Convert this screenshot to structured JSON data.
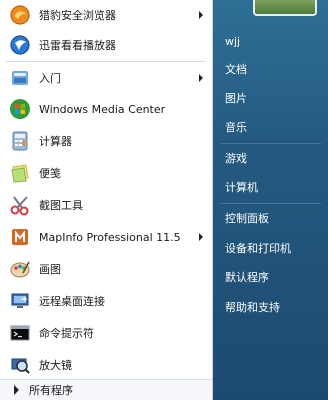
{
  "programs": [
    {
      "label": "猎豹安全浏览器",
      "icon": "cheetah-browser-icon",
      "has_arrow": true
    },
    {
      "label": "迅雷看看播放器",
      "icon": "xunlei-player-icon",
      "has_arrow": false
    },
    {
      "label": "入门",
      "icon": "getting-started-icon",
      "has_arrow": true
    },
    {
      "label": "Windows Media Center",
      "icon": "windows-media-center-icon",
      "has_arrow": false
    },
    {
      "label": "计算器",
      "icon": "calculator-icon",
      "has_arrow": false
    },
    {
      "label": "便笺",
      "icon": "sticky-notes-icon",
      "has_arrow": false
    },
    {
      "label": "截图工具",
      "icon": "snipping-tool-icon",
      "has_arrow": false
    },
    {
      "label": "MapInfo Professional 11.5",
      "icon": "mapinfo-icon",
      "has_arrow": true
    },
    {
      "label": "画图",
      "icon": "paint-icon",
      "has_arrow": false
    },
    {
      "label": "远程桌面连接",
      "icon": "remote-desktop-icon",
      "has_arrow": false
    },
    {
      "label": "命令提示符",
      "icon": "command-prompt-icon",
      "has_arrow": false
    },
    {
      "label": "放大镜",
      "icon": "magnifier-icon",
      "has_arrow": false
    }
  ],
  "all_programs_label": "所有程序",
  "right_items": [
    {
      "label": "wjj"
    },
    {
      "label": "文档"
    },
    {
      "label": "图片"
    },
    {
      "label": "音乐"
    },
    {
      "label": "游戏"
    },
    {
      "label": "计算机"
    },
    {
      "label": "控制面板"
    },
    {
      "label": "设备和打印机"
    },
    {
      "label": "默认程序"
    },
    {
      "label": "帮助和支持"
    }
  ],
  "colors": {
    "right_pane": "#245a82",
    "left_pane": "#ffffff"
  }
}
